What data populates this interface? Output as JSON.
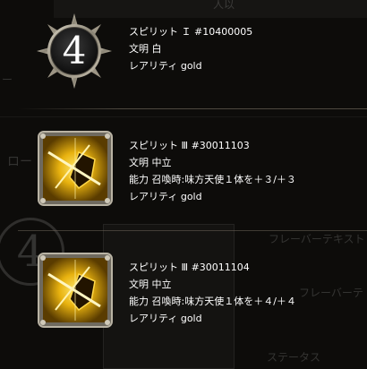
{
  "background": {
    "texts": [
      "人以",
      "ー",
      "ロー",
      "フレーバーテキスト",
      "フレーバーテ",
      "ステータス"
    ],
    "number": "4"
  },
  "spirits": [
    {
      "icon": "number-4-medallion-icon",
      "number": "4",
      "name": "スピリット Ｉ #10400005",
      "civilization": "文明 白",
      "rarity": "レアリティ gold"
    },
    {
      "icon": "golden-shield-sword-icon",
      "name": "スピリット Ⅲ #30011103",
      "civilization": "文明 中立",
      "ability": "能力 召喚時:味方天使１体を＋３/＋３",
      "rarity": "レアリティ gold"
    },
    {
      "icon": "golden-shield-sword-icon",
      "name": "スピリット Ⅲ #30011104",
      "civilization": "文明 中立",
      "ability": "能力 召喚時:味方天使１体を＋４/＋４",
      "rarity": "レアリティ gold"
    }
  ],
  "colors": {
    "icon_gold": "#e8b20f",
    "frame_silver": "#9a9486",
    "text": "#ffffff"
  }
}
